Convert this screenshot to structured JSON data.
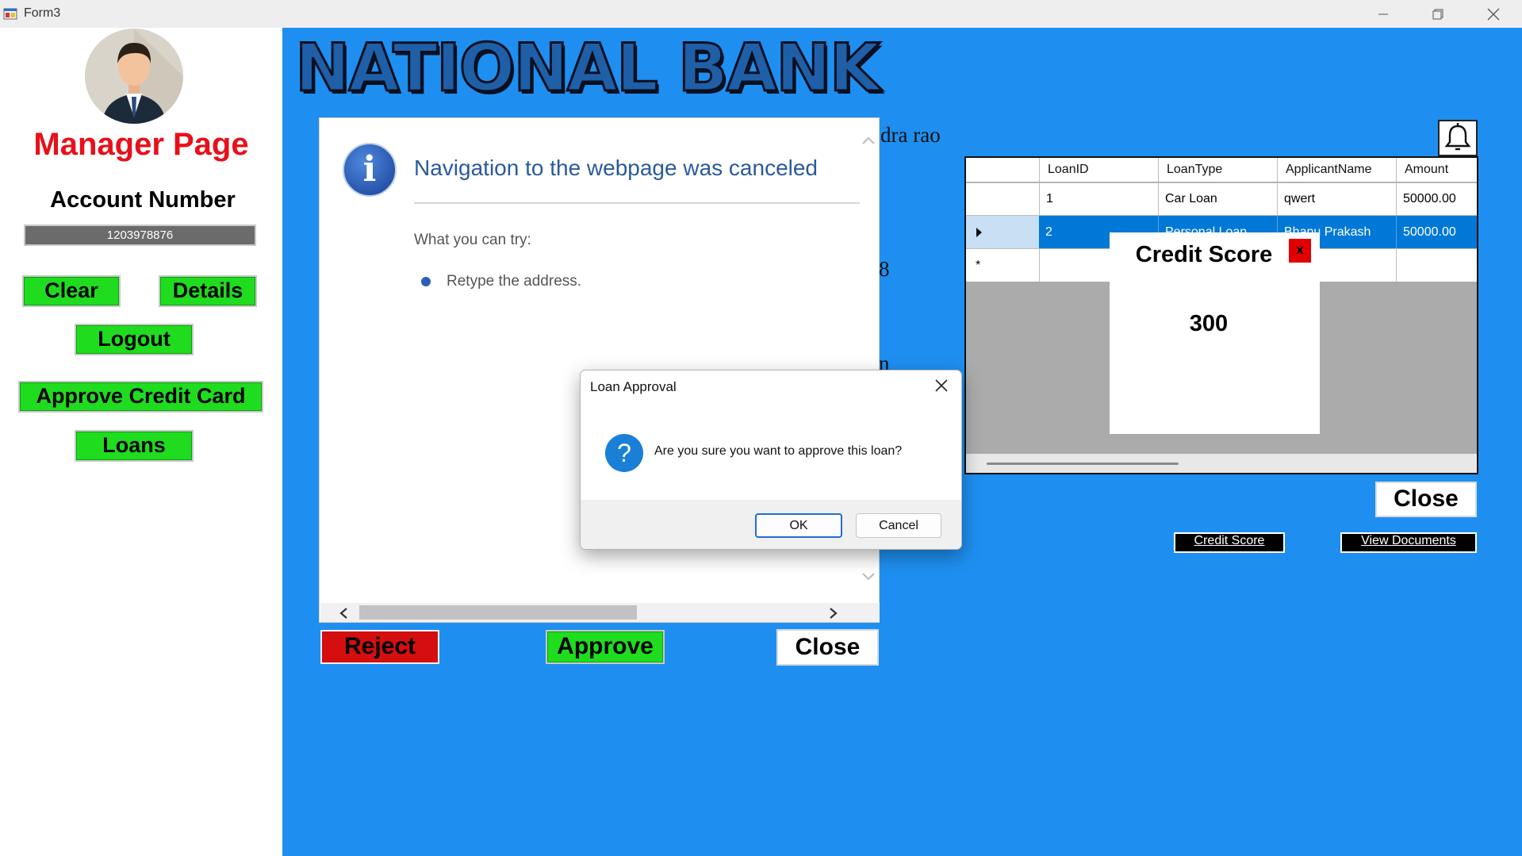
{
  "window": {
    "title": "Form3",
    "minimize_icon": "minimize-icon",
    "restore_icon": "restore-icon",
    "close_icon": "close-icon"
  },
  "sidebar": {
    "page_title": "Manager Page",
    "account_label": "Account Number",
    "account_number": "1203978876",
    "buttons": {
      "clear": "Clear",
      "details": "Details",
      "logout": "Logout",
      "approve_credit_card": "Approve Credit Card",
      "loans": "Loans"
    }
  },
  "bank": {
    "name": "NATIONAL BANK"
  },
  "browser": {
    "heading": "Navigation to the webpage was canceled",
    "try_label": "What you can try:",
    "suggestion": "Retype the address."
  },
  "background_snippets": {
    "name_fragment": "dra rao",
    "digit_fragment": "8",
    "letter_fragment": "n"
  },
  "loan_actions": {
    "reject": "Reject",
    "approve": "Approve",
    "close": "Close"
  },
  "loans_grid": {
    "columns": [
      "LoanID",
      "LoanType",
      "ApplicantName",
      "Amount"
    ],
    "rows": [
      {
        "LoanID": "1",
        "LoanType": "Car Loan",
        "ApplicantName": "qwert",
        "Amount": "50000.00"
      },
      {
        "LoanID": "2",
        "LoanType": "Personal Loan",
        "ApplicantName": "Bhanu Prakash",
        "Amount": "50000.00"
      }
    ],
    "selected_row_index": 1,
    "new_row_marker": "*"
  },
  "credit_score_popup": {
    "title": "Credit Score",
    "close_label": "x",
    "score": "300"
  },
  "grid_panel_buttons": {
    "close": "Close",
    "credit_score": "Credit Score",
    "view_documents": "View Documents"
  },
  "dialog": {
    "title": "Loan Approval",
    "message": "Are you sure you want to approve this loan?",
    "ok": "OK",
    "cancel": "Cancel",
    "close_glyph": "✕"
  },
  "colors": {
    "main_background": "#1e8ff0",
    "button_green": "#1fdc1f",
    "button_red": "#d50f0f",
    "title_red": "#e8101a",
    "selection_blue": "#0078d7"
  }
}
